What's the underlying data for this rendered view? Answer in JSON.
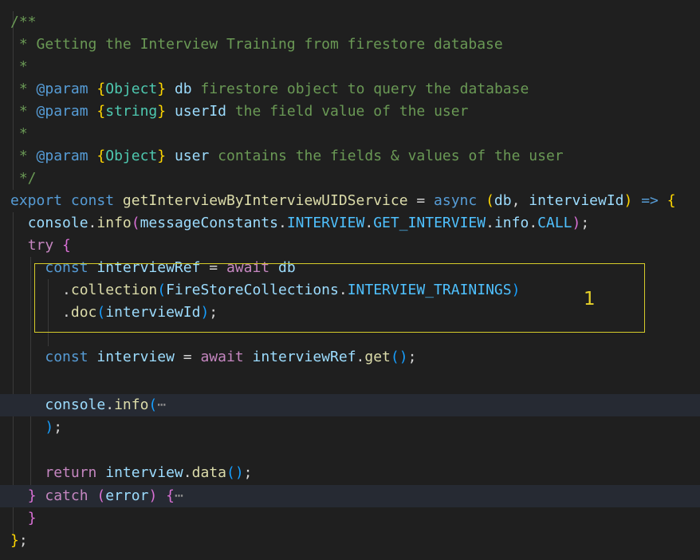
{
  "doc_comment": {
    "open": "/**",
    "star": " *",
    "summary": "Getting the Interview Training from firestore database",
    "close": " */",
    "params": [
      {
        "tag": "@param",
        "type": "Object",
        "name": "db",
        "desc": "firestore object to query the database"
      },
      {
        "tag": "@param",
        "type": "string",
        "name": "userId",
        "desc": "the field value of the user"
      },
      {
        "tag": "@param",
        "type": "Object",
        "name": "user",
        "desc": "contains the fields & values of the user"
      }
    ]
  },
  "code": {
    "export_kw": "export",
    "const_kw": "const",
    "fn_name": "getInterviewByInterviewUIDService",
    "async_kw": "async",
    "arg1": "db",
    "arg2": "interviewId",
    "arrow": "=>",
    "console": "console",
    "info": "info",
    "message_constants": "messageConstants",
    "interview_const": "INTERVIEW",
    "get_interview_const": "GET_INTERVIEW",
    "info_prop": "info",
    "call_const": "CALL",
    "try_kw": "try",
    "interview_ref": "interviewRef",
    "await_kw": "await",
    "db_ref": "db",
    "collection_fn": "collection",
    "firestore_collections": "FireStoreCollections",
    "trainings_const": "INTERVIEW_TRAININGS",
    "doc_fn": "doc",
    "interview_id": "interviewId",
    "interview_var": "interview",
    "get_fn": "get",
    "fold_marker": "⋯",
    "return_kw": "return",
    "data_fn": "data",
    "catch_kw": "catch",
    "error_var": "error"
  },
  "annotation": {
    "number": "1"
  }
}
